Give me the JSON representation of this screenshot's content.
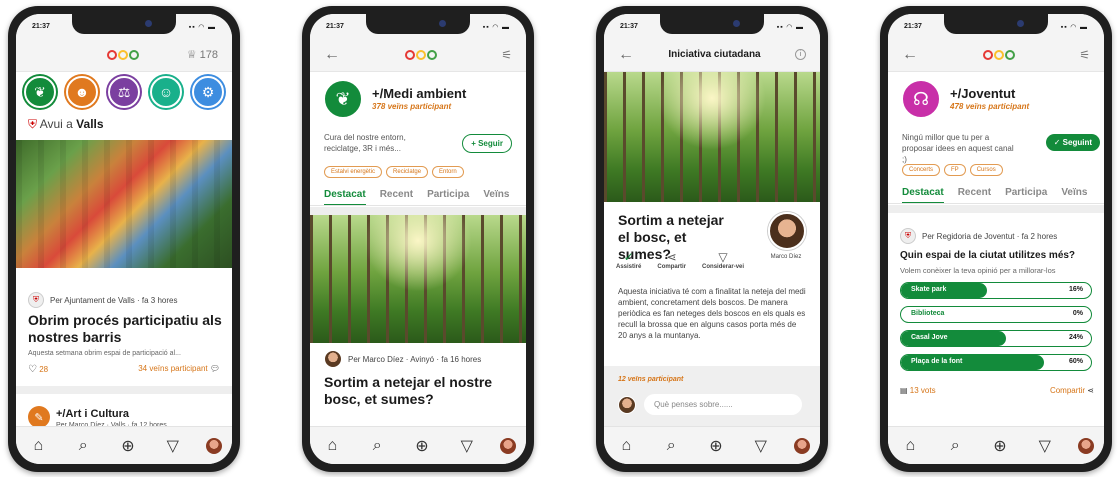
{
  "phone1": {
    "status_time": "21:37",
    "points": "178",
    "categories": [
      {
        "icon": "globe-leaf-icon",
        "color": "#138b3b"
      },
      {
        "icon": "people-icon",
        "color": "#e0791f"
      },
      {
        "icon": "scales-icon",
        "color": "#7b3fa0"
      },
      {
        "icon": "smile-icon",
        "color": "#19b08b"
      },
      {
        "icon": "robot-icon",
        "color": "#3d8de0"
      }
    ],
    "today_prefix": "Avui a",
    "today_city": "Valls",
    "post": {
      "author": "Per Ajuntament de Valls · fa 3 hores",
      "title": "Obrim procés participatiu als nostres barris",
      "excerpt": "Aquesta setmana obrim espai de participació al...",
      "likes": "28",
      "participants": "34 veïns participant"
    },
    "next_channel": {
      "name": "+/Art i Cultura",
      "author": "Per Marco Díez · Valls · fa 12 hores"
    }
  },
  "phone2": {
    "status_time": "21:37",
    "channel_name": "+/Medi ambient",
    "channel_count": "378 veïns participant",
    "description": "Cura del nostre entorn, reciclatge, 3R i més...",
    "follow_label": "+ Seguir",
    "tags": [
      "Estalvi energètic",
      "Reciclatge",
      "Entorn"
    ],
    "tabs": [
      "Destacat",
      "Recent",
      "Participa",
      "Veïns"
    ],
    "post_author": "Per Marco Díez · Avinyó · fa 16 hores",
    "post_title": "Sortim a netejar el nostre bosc, et sumes?"
  },
  "phone3": {
    "status_time": "21:37",
    "title": "Iniciativa ciutadana",
    "post_title": "Sortim a netejar el bosc, et sumes?",
    "actions": [
      "Assistiré",
      "Compartir",
      "Considerar-vei"
    ],
    "author_name": "Marco Díez",
    "body": "Aquesta iniciativa té com a finalitat la neteja del medi ambient, concretament dels boscos. De manera periòdica es fan neteges dels boscos en els quals es recull la brossa que en alguns casos porta més de 20 anys a la muntanya.",
    "participants": "12 veïns participant",
    "comment_placeholder": "Què penses sobre......"
  },
  "phone4": {
    "status_time": "21:37",
    "channel_name": "+/Joventut",
    "channel_count": "478 veïns participant",
    "description": "Ningú millor que tu per a proposar idees en aquest canal ;)",
    "following_label": "✓ Seguint",
    "tags": [
      "Concerts",
      "FP",
      "Cursos"
    ],
    "tabs": [
      "Destacat",
      "Recent",
      "Participa",
      "Veïns"
    ],
    "poll_author": "Per Regidoria de Joventut · fa 2 hores",
    "poll_question": "Quin espai de la ciutat utilitzes més?",
    "poll_subtitle": "Volem conèixer la teva opinió per a millorar-los",
    "options": [
      {
        "label": "Skate park",
        "pct": "16%",
        "value": 0.45
      },
      {
        "label": "Biblioteca",
        "pct": "0%",
        "value": 0.0
      },
      {
        "label": "Casal Jove",
        "pct": "24%",
        "value": 0.55
      },
      {
        "label": "Plaça de la font",
        "pct": "60%",
        "value": 0.75
      }
    ],
    "votes": "13 vots",
    "share": "Compartir"
  },
  "colors": {
    "accent_green": "#138b3b",
    "accent_orange": "#d67518",
    "joventut_pink": "#c82fa8"
  }
}
